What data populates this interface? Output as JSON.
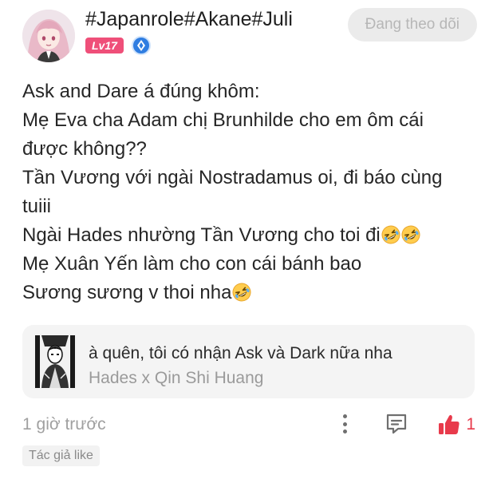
{
  "post": {
    "username": "#Japanrole#Akane#Juli",
    "level": "Lv17",
    "follow_label": "Đang theo dõi",
    "lines": [
      "Ask and Dare á đúng khôm:",
      "Mẹ Eva cha Adam chị Brunhilde cho em ôm cái",
      "được không??",
      "Tần Vương với ngài Nostradamus oi, đi báo cùng",
      "tuiii",
      "Ngài Hades nhường Tần Vương cho toi đi",
      "Mẹ Xuân Yến làm cho con cái bánh bao",
      "Sương sương v thoi nha"
    ],
    "emojis": [
      "rolling-on-floor-laughing",
      "rolling-on-floor-laughing",
      "rolling-on-floor-laughing"
    ]
  },
  "linked_card": {
    "title": "à quên, tôi có nhận Ask và Dark nữa nha",
    "subtitle": "Hades x Qin Shi Huang"
  },
  "footer": {
    "timestamp": "1 giờ trước",
    "like_count": "1",
    "author_tag": "Tác giả like"
  },
  "colors": {
    "level_badge": "#ef4f79",
    "verify_badge": "#2f7de1",
    "like": "#e83a4b",
    "card_bg": "#f4f4f4"
  }
}
